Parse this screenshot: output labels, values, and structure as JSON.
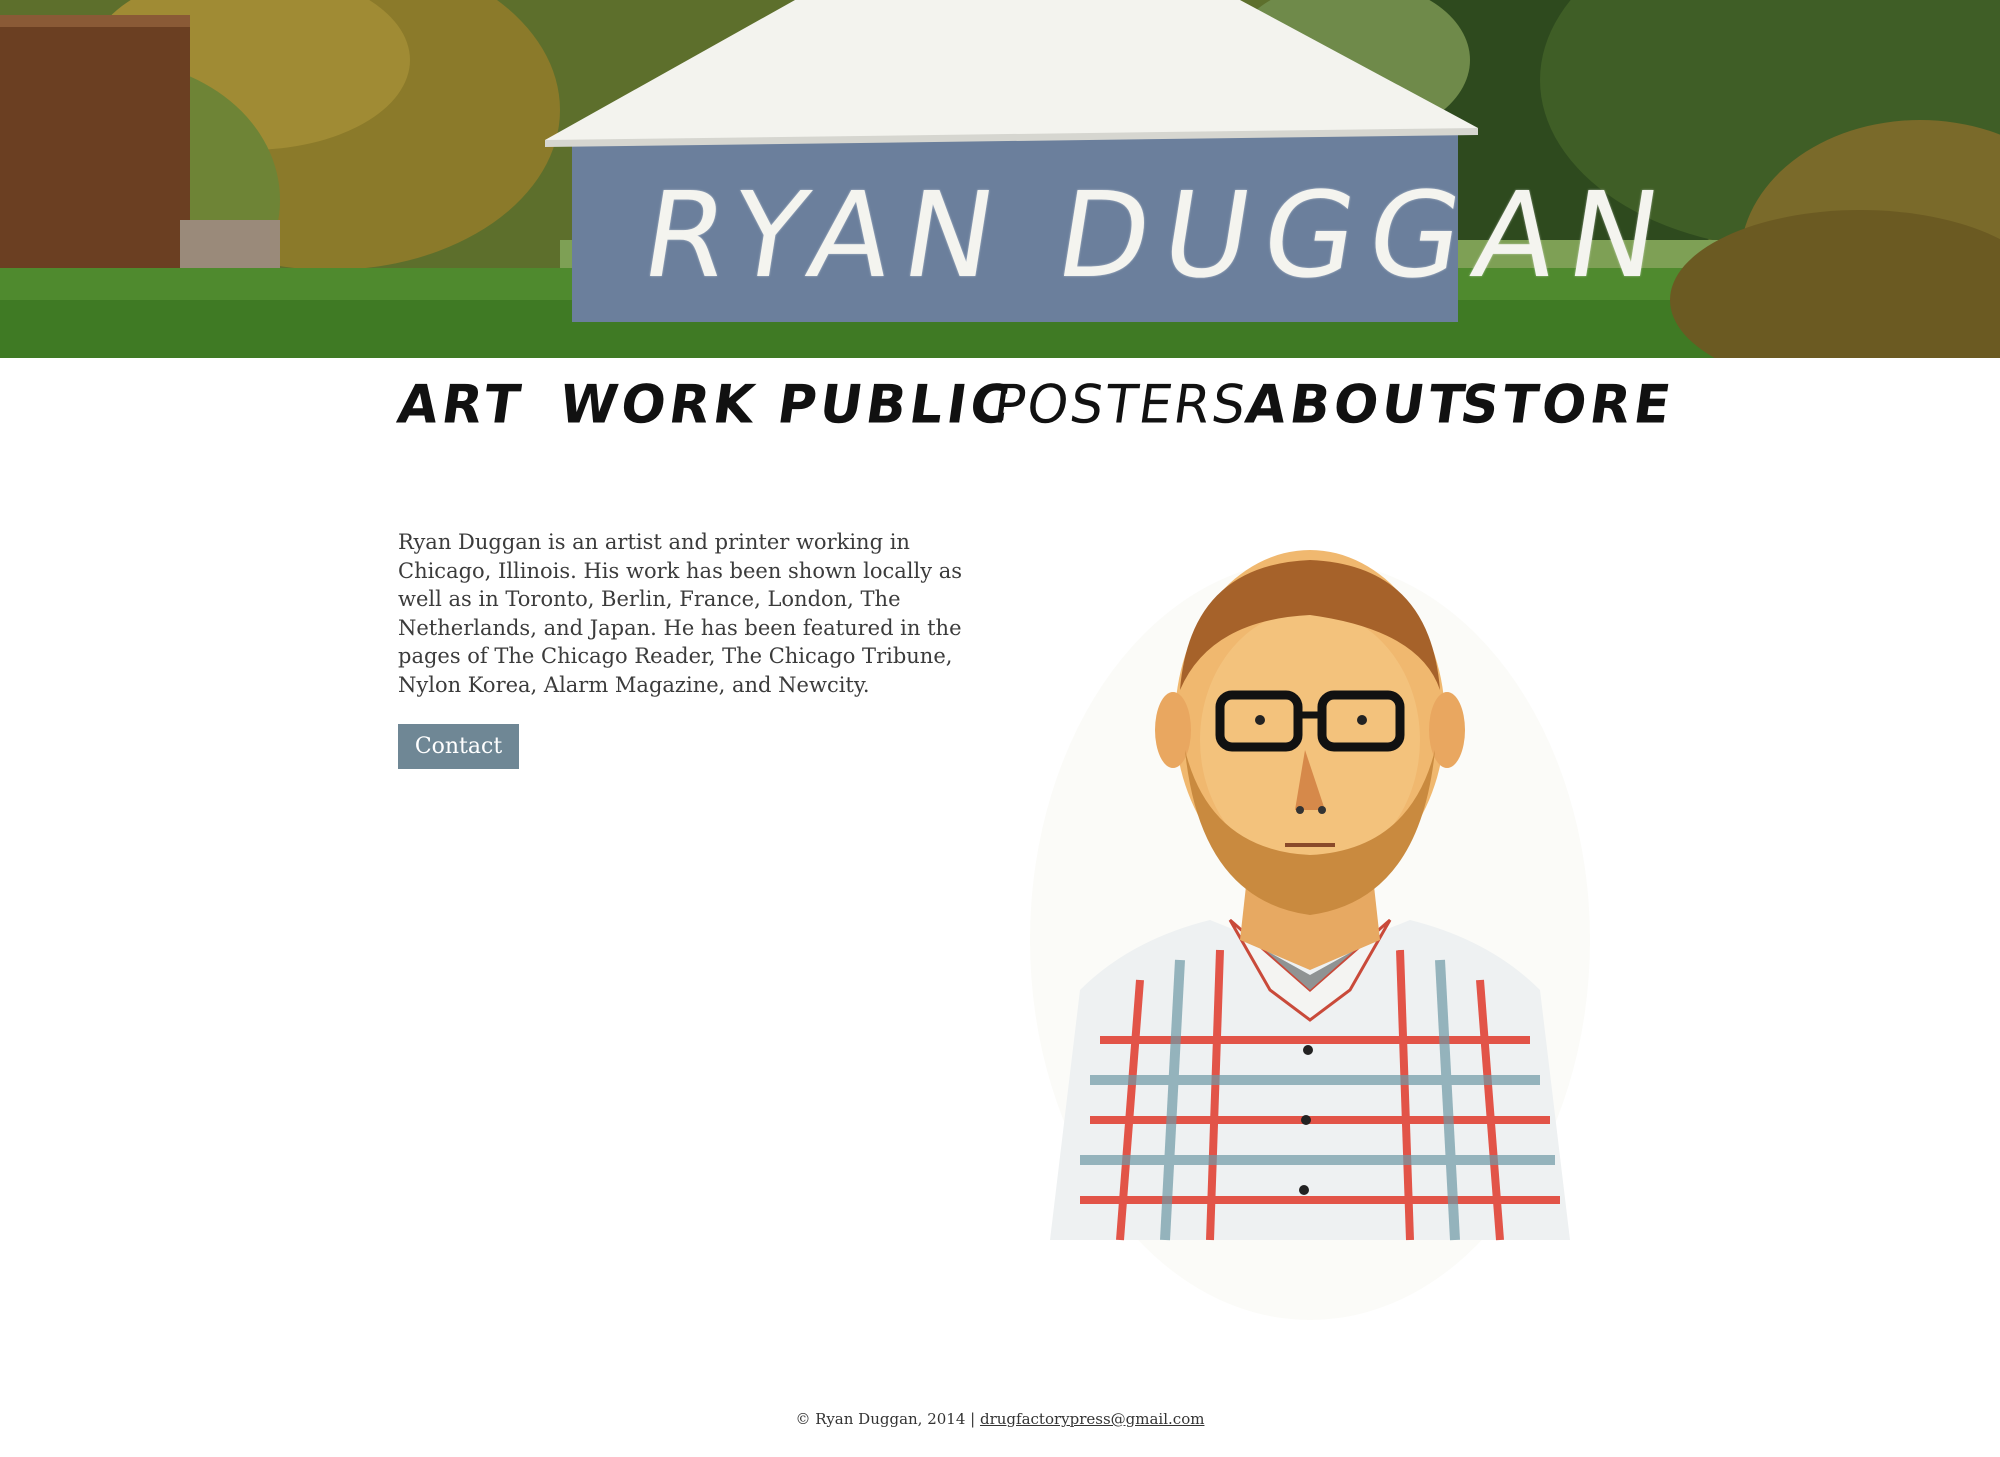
{
  "header": {
    "title": "RYAN DUGGAN"
  },
  "nav": {
    "items": [
      {
        "label": "ART"
      },
      {
        "label": "WORK"
      },
      {
        "label": "PUBLIC"
      },
      {
        "label": "POSTERS"
      },
      {
        "label": "ABOUT"
      },
      {
        "label": "STORE"
      }
    ]
  },
  "about": {
    "bio": "Ryan Duggan is an artist and printer working in Chicago, Illinois. His work has been shown locally as well as in Toronto, Berlin, France, London, The Netherlands, and Japan. He has been featured in the pages of The Chicago Reader, The Chicago Tribune, Nylon Korea, Alarm Magazine, and Newcity.",
    "contact_label": "Contact"
  },
  "footer": {
    "copyright": "© Ryan Duggan, 2014 | ",
    "email": "drugfactorypress@gmail.com"
  },
  "colors": {
    "button_bg": "#6f8795",
    "barn_wall": "#6b7f9c",
    "grass": "#4f8a2e"
  }
}
